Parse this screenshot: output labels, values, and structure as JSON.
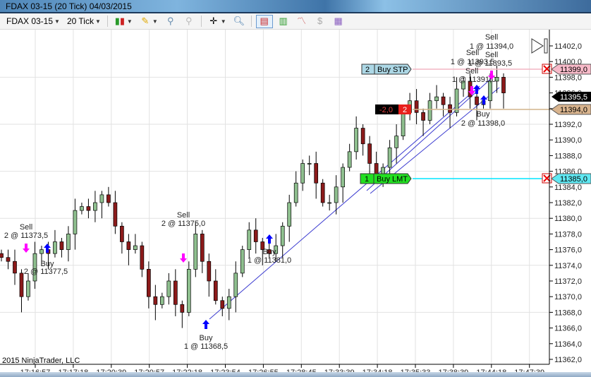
{
  "window": {
    "title": "FDAX 03-15 (20 Tick)  04/03/2015"
  },
  "toolbar": {
    "instrument": "FDAX 03-15",
    "interval": "20 Tick",
    "icons": [
      "candlestick-chart-icon",
      "pencil-draw-icon",
      "add-indicator-icon",
      "remove-indicator-icon",
      "crosshair-icon",
      "zoom-icon",
      "chart-trader-icon",
      "bar-style-icon",
      "strategies-icon",
      "dollar-icon",
      "data-box-icon"
    ]
  },
  "copyright": "2015 NinjaTrader, LLC",
  "colors": {
    "up": "#8fc08f",
    "down": "#8b1a1a",
    "buy_stp_line": "#f2b6c3",
    "buy_lmt_line": "#00e5ff",
    "position_line": "#d2b48c",
    "trend_line": "#3b3bd0",
    "buy_arrow": "#0000ff",
    "sell_arrow": "#ff00ff"
  },
  "chart_data": {
    "type": "candlestick",
    "title": "",
    "ylim": [
      11361,
      11404
    ],
    "y_ticks": [
      "11402,0",
      "11400,0",
      "11398,0",
      "11396,0",
      "11394,0",
      "11392,0",
      "11390,0",
      "11388,0",
      "11386,0",
      "11384,0",
      "11382,0",
      "11380,0",
      "11378,0",
      "11376,0",
      "11374,0",
      "11372,0",
      "11370,0",
      "11368,0",
      "11366,0",
      "11364,0",
      "11362,0"
    ],
    "x_ticks": [
      "17:16:57",
      "17:17:18",
      "17:20:39",
      "17:20:57",
      "17:22:18",
      "17:23:54",
      "17:26:55",
      "17:28:45",
      "17:33:39",
      "17:34:18",
      "17:35:33",
      "17:38:39",
      "17:44:18",
      "17:47:39"
    ],
    "closes": [
      11375,
      11374.5,
      11373,
      11370,
      11372,
      11375.5,
      11376,
      11375.5,
      11377,
      11376,
      11378,
      11381,
      11381.5,
      11381,
      11382,
      11383,
      11382,
      11379,
      11377,
      11376,
      11376.5,
      11373.5,
      11370,
      11369,
      11370,
      11372,
      11369,
      11368,
      11373.5,
      11378,
      11374.5,
      11372,
      11369.5,
      11368.5,
      11370,
      11373,
      11376,
      11378.5,
      11377,
      11376,
      11375.5,
      11376.5,
      11379,
      11382,
      11384.5,
      11387,
      11387,
      11384.5,
      11382,
      11382,
      11384,
      11386.5,
      11388.5,
      11391.5,
      11389.5,
      11387,
      11385,
      11386.5,
      11389,
      11390.5,
      11393.5,
      11395,
      11393.5,
      11392.5,
      11395,
      11395.5,
      11394.5,
      11393.5,
      11396.5,
      11397.5,
      11395.5,
      11394.5,
      11395,
      11397.5,
      11398,
      11396
    ],
    "last_price": "11395,5",
    "orders": [
      {
        "qty": "2",
        "label": "Buy STP",
        "price": "11399,0"
      },
      {
        "qty": "1",
        "label": "Buy LMT",
        "price": "11385,0"
      }
    ],
    "position": {
      "pnl": "-2,0",
      "qty": "2",
      "price": "11394,0"
    },
    "executions": [
      {
        "side": "Sell",
        "text": "2 @ 11373,5"
      },
      {
        "side": "Buy",
        "text": "2 @ 11377,5"
      },
      {
        "side": "Sell",
        "text": "2 @ 11375,0"
      },
      {
        "side": "Buy",
        "text": "1 @ 11368,5"
      },
      {
        "side": "Buy",
        "text": "1 @ 11381,0"
      },
      {
        "side": "Sell",
        "text": "1 @ 11394,0"
      },
      {
        "side": "Sell",
        "text": "1 @ 11393,5"
      },
      {
        "side": "Sell",
        "text": "1 @ 11393,5"
      },
      {
        "side": "Sell",
        "text": "1 @ 11391,0"
      },
      {
        "side": "Buy",
        "text": "2 @ 11398,0"
      }
    ]
  }
}
